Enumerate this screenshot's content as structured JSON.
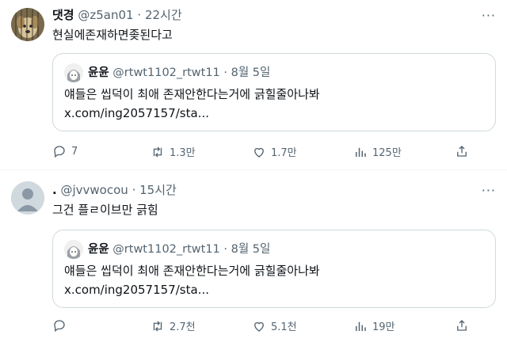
{
  "tweets": [
    {
      "name": "댓경",
      "handle": "@z5an01",
      "dot": "·",
      "time": "22시간",
      "more": "···",
      "text": "현실에존재하면좆된다고",
      "quote": {
        "name": "윤윤",
        "handle": "@rtwt1102_rtwt11",
        "dot": "·",
        "date": "8월 5일",
        "text": "얘들은 씹덕이 최애 존재안한다는거에 긁힐줄아나봐",
        "link": "x.com/ing2057157/sta..."
      },
      "replies": "7",
      "retweets": "1.3만",
      "likes": "1.7만",
      "views": "125만"
    },
    {
      "name": ".",
      "handle": "@jvvwocou",
      "dot": "·",
      "time": "15시간",
      "more": "···",
      "text": "그건 플ㄹ이브만 긁힘",
      "quote": {
        "name": "윤윤",
        "handle": "@rtwt1102_rtwt11",
        "dot": "·",
        "date": "8월 5일",
        "text": "얘들은 씹덕이 최애 존재안한다는거에 긁힐줄아나봐",
        "link": "x.com/ing2057157/sta..."
      },
      "replies": "",
      "retweets": "2.7천",
      "likes": "5.1천",
      "views": "19만"
    }
  ],
  "icons": {
    "reply": "reply-icon",
    "retweet": "retweet-icon",
    "like": "heart-icon",
    "views": "views-icon",
    "share": "share-icon",
    "more": "more-icon"
  },
  "colors": {
    "text": "#0f1419",
    "secondary": "#536471",
    "border": "#cfd9de"
  }
}
